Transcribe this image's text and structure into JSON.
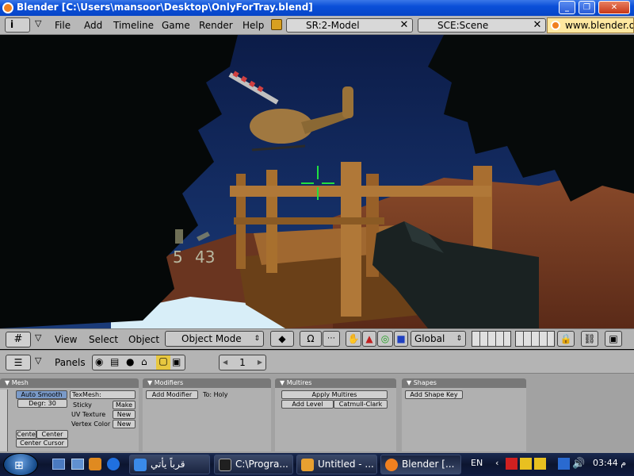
{
  "titlebar": {
    "title": "Blender [C:\\Users\\mansoor\\Desktop\\OnlyForTray.blend]"
  },
  "menubar": {
    "items": [
      "File",
      "Add",
      "Timeline",
      "Game",
      "Render",
      "Help"
    ],
    "screen_field": "SR:2-Model",
    "scene_field": "SCE:Scene",
    "url": "www.blender.o"
  },
  "hud": {
    "ammo_clip": "5",
    "ammo_total": "43"
  },
  "view3d_header": {
    "menus": [
      "View",
      "Select",
      "Object"
    ],
    "mode": "Object Mode",
    "orientation": "Global"
  },
  "buttons_header": {
    "panels_label": "Panels",
    "frame": "1"
  },
  "panels": {
    "mesh": {
      "title": "Mesh",
      "auto_smooth": "Auto Smooth",
      "degr": "Degr: 30",
      "texmesh": "TexMesh:",
      "sticky": "Sticky",
      "make": "Make",
      "uv_texture": "UV Texture",
      "new1": "New",
      "vertex_color": "Vertex Color",
      "new2": "New",
      "centre": "Cente",
      "center_new": "Center Ne",
      "center_cursor": "Center Cursor"
    },
    "modifiers": {
      "title": "Modifiers",
      "add_modifier": "Add Modifier",
      "to": "To: Holy"
    },
    "multires": {
      "title": "Multires",
      "apply": "Apply Multires",
      "add_level": "Add Level",
      "catmull": "Catmull-Clark"
    },
    "shapes": {
      "title": "Shapes",
      "add_shape_key": "Add Shape Key"
    }
  },
  "taskbar": {
    "tasks": [
      "قرباً يأتي",
      "C:\\Progra...",
      "Untitled - ...",
      "Blender [..."
    ],
    "lang": "EN",
    "clock": "03:44 م"
  },
  "colors": {
    "titlebar": "#0a4fd8",
    "blender_ui": "#b4b4b4",
    "sky": "#102a60",
    "ground": "#8a4a2a",
    "wood": "#b07838"
  }
}
